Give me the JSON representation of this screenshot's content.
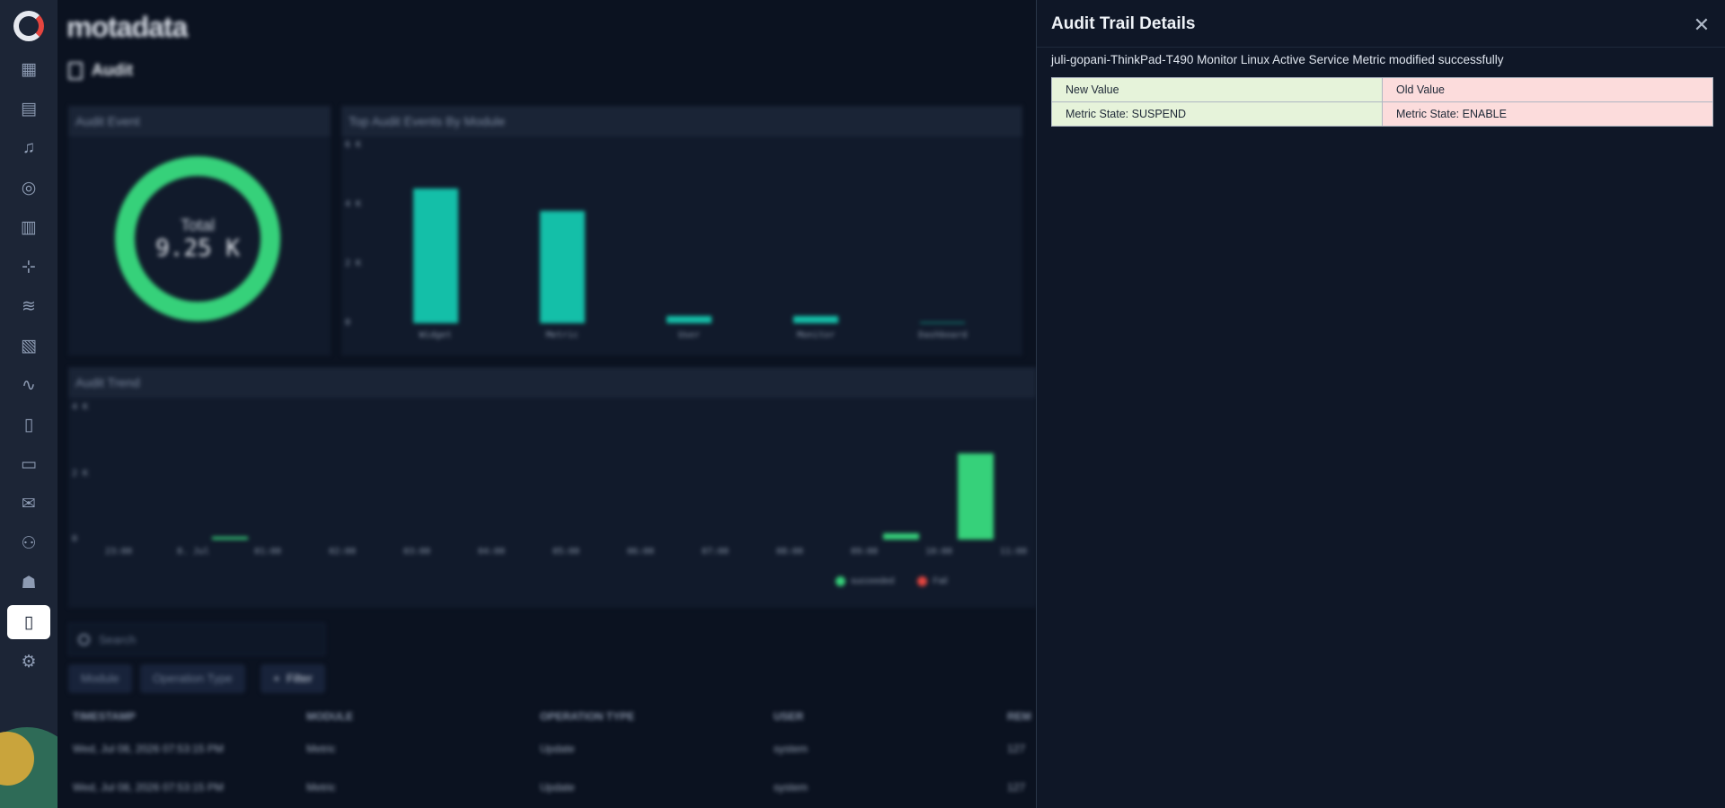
{
  "brand": "motadata",
  "page_title": "Audit",
  "sidebar": {
    "icons": [
      "dashboard-icon",
      "inventory-icon",
      "alert-icon",
      "discovery-icon",
      "reports-icon",
      "topology-icon",
      "netflow-icon",
      "logs-icon",
      "metric-explorer-icon",
      "document-icon",
      "monitor-icon",
      "chat-icon",
      "group-icon",
      "robot-icon",
      "audit-icon",
      "settings-icon"
    ],
    "active_index": 14
  },
  "audit_event": {
    "title": "Audit Event",
    "total_label": "Total",
    "total_value": "9.25 K",
    "ring_color": "#36d17a"
  },
  "chart_data": [
    {
      "type": "bar",
      "title": "Top Audit Events By Module",
      "categories": [
        "Widget",
        "Metric",
        "User",
        "Monitor",
        "Dashboard"
      ],
      "values": [
        4550,
        3800,
        250,
        250,
        30
      ],
      "ylim": [
        0,
        6000
      ],
      "y_ticks": [
        "6 K",
        "4 K",
        "2 K",
        "0"
      ],
      "bar_color": "#14bfa8"
    },
    {
      "type": "bar",
      "title": "Audit Trend",
      "categories": [
        "23:00",
        "8. Jul",
        "01:00",
        "02:00",
        "03:00",
        "04:00",
        "05:00",
        "06:00",
        "07:00",
        "08:00",
        "09:00",
        "10:00",
        "11:00"
      ],
      "series": [
        {
          "name": "succeeded",
          "color": "#36d17a",
          "values": [
            0,
            60,
            0,
            0,
            0,
            0,
            0,
            0,
            0,
            0,
            200,
            2600,
            0
          ]
        },
        {
          "name": "Fail",
          "color": "#e5453f",
          "values": [
            0,
            0,
            0,
            0,
            0,
            0,
            0,
            0,
            0,
            0,
            0,
            0,
            0
          ]
        }
      ],
      "ylim": [
        0,
        4000
      ],
      "y_ticks": [
        "4 K",
        "2 K",
        "0"
      ]
    }
  ],
  "filters": {
    "search_placeholder": "Search",
    "chips": [
      "Module",
      "Operation Type"
    ],
    "filter_label": "Filter"
  },
  "table": {
    "columns": [
      "TIMESTAMP",
      "MODULE",
      "OPERATION TYPE",
      "USER",
      "REM"
    ],
    "rows": [
      [
        "Wed, Jul 08, 2026 07:53:15 PM",
        "Metric",
        "Update",
        "system",
        "127"
      ],
      [
        "Wed, Jul 08, 2026 07:53:15 PM",
        "Metric",
        "Update",
        "system",
        "127"
      ]
    ]
  },
  "drawer": {
    "title": "Audit Trail Details",
    "message": "juli-gopani-ThinkPad-T490 Monitor Linux Active Service Metric modified successfully",
    "new_header": "New Value",
    "old_header": "Old Value",
    "new_value": "Metric State: SUSPEND",
    "old_value": "Metric State: ENABLE",
    "new_bg": "#e6f3da",
    "old_bg": "#fcdcdc"
  }
}
